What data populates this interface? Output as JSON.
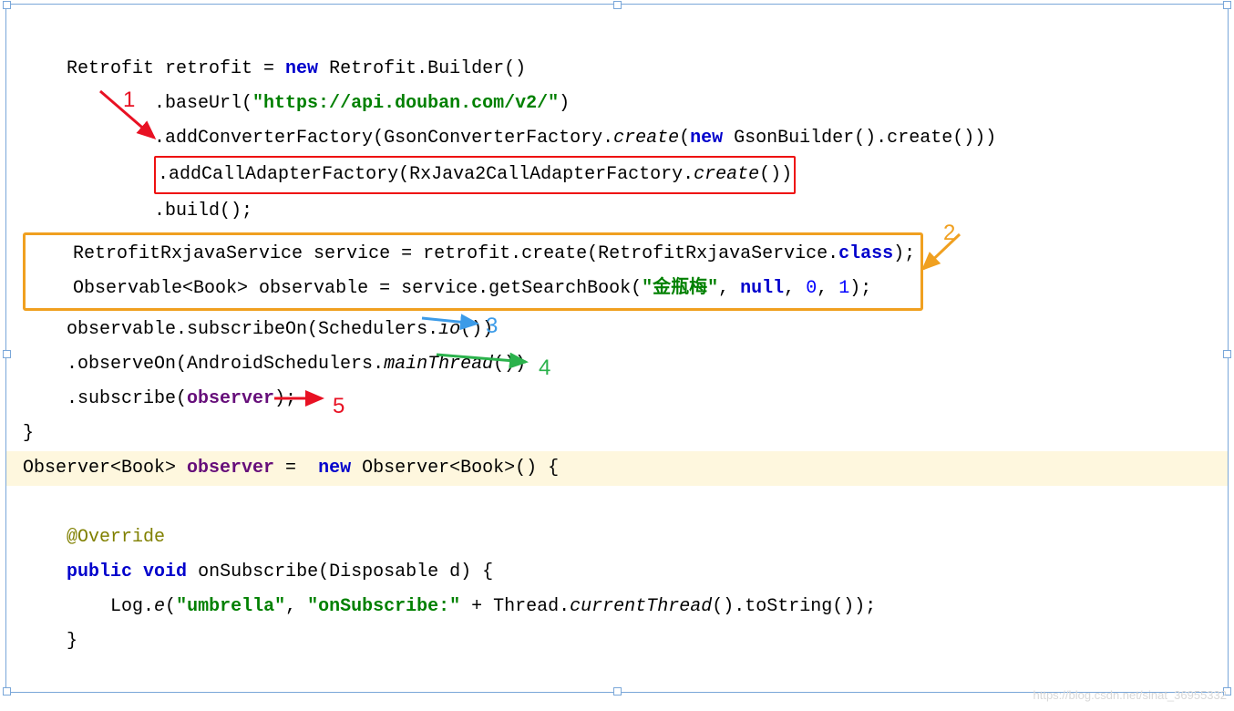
{
  "code": {
    "line1_a": "    Retrofit retrofit = ",
    "line1_new": "new",
    "line1_b": " Retrofit.Builder()",
    "line2_a": "            .baseUrl(",
    "line2_str": "\"https://api.douban.com/v2/\"",
    "line2_b": ")",
    "line3_a": "            .addConverterFactory(GsonConverterFactory.",
    "line3_create": "create",
    "line3_b": "(",
    "line3_new": "new",
    "line3_c": " GsonBuilder().create()))",
    "line4_a": ".addCallAdapterFactory(RxJava2CallAdapterFactory.",
    "line4_create": "create",
    "line4_b": "())",
    "line5": "            .build();",
    "box2_l1_a": "RetrofitRxjavaService service = retrofit.create(RetrofitRxjavaService.",
    "box2_l1_class": "class",
    "box2_l1_b": ");",
    "box2_l2_a": "Observable<Book> observable = service.getSearchBook(",
    "box2_l2_str": "\"金瓶梅\"",
    "box2_l2_b": ", ",
    "box2_l2_null": "null",
    "box2_l2_c": ", ",
    "box2_l2_n0": "0",
    "box2_l2_d": ", ",
    "box2_l2_n1": "1",
    "box2_l2_e": ");",
    "line8_a": "    observable.subscribeOn(Schedulers.",
    "line8_io": "io",
    "line8_b": "())",
    "line9_a": "    .observeOn(AndroidSchedulers.",
    "line9_mt": "mainThread",
    "line9_b": "())",
    "line10_a": "    .subscribe(",
    "line10_obs": "observer",
    "line10_b": ");",
    "line11": "}",
    "obs_a": "Observer<Book> ",
    "obs_name": "observer",
    "obs_b": " =  ",
    "obs_new": "new",
    "obs_c": " Observer<Book>() {",
    "override": "@Override",
    "method_a": "    ",
    "method_pub": "public",
    "method_sp": " ",
    "method_void": "void",
    "method_b": " onSubscribe(Disposable d) {",
    "log_a": "        Log.",
    "log_e": "e",
    "log_b": "(",
    "log_s1": "\"umbrella\"",
    "log_c": ", ",
    "log_s2": "\"onSubscribe:\"",
    "log_d": " + Thread.",
    "log_ct": "currentThread",
    "log_f": "().toString());",
    "close_m": "    }"
  },
  "labels": {
    "n1": "1",
    "n2": "2",
    "n3": "3",
    "n4": "4",
    "n5": "5"
  },
  "watermark": "https://blog.csdn.net/sinat_36955332"
}
